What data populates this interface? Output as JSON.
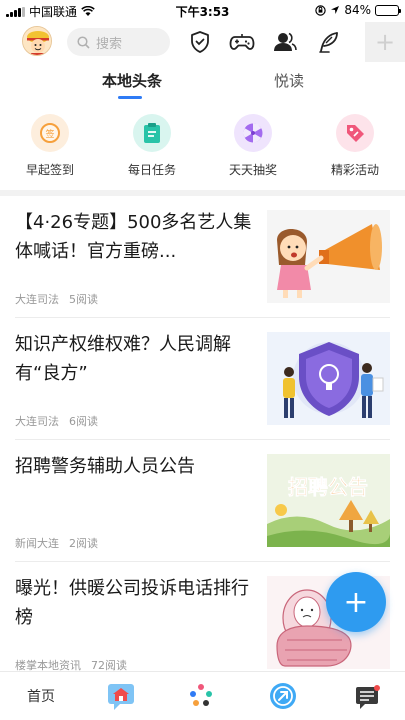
{
  "status_bar": {
    "carrier": "中国联通",
    "time": "下午3:53",
    "battery_text": "84%",
    "battery_level": 0.84
  },
  "top_bar": {
    "search_placeholder": "搜索"
  },
  "tabs": [
    {
      "label": "本地头条",
      "active": true
    },
    {
      "label": "悦读",
      "active": false
    }
  ],
  "quick_entries": [
    {
      "label": "早起签到",
      "icon": "sign-in-icon",
      "color": "#f6a03c"
    },
    {
      "label": "每日任务",
      "icon": "task-clipboard-icon",
      "color": "#28c3a8"
    },
    {
      "label": "天天抽奖",
      "icon": "lottery-wheel-icon",
      "color": "#a36bef"
    },
    {
      "label": "精彩活动",
      "icon": "gift-tag-icon",
      "color": "#f0577a"
    }
  ],
  "news": [
    {
      "title": "【4·26专题】500多名艺人集体喊话！官方重磅...",
      "source": "大连司法",
      "reads": "5阅读"
    },
    {
      "title": "知识产权维权难？人民调解有“良方”",
      "source": "大连司法",
      "reads": "6阅读"
    },
    {
      "title": "招聘警务辅助人员公告",
      "source": "新闻大连",
      "reads": "2阅读",
      "thumb_text": "招聘公告"
    },
    {
      "title": "曝光！供暖公司投诉电话排行榜",
      "source": "楼掌本地资讯",
      "reads": "72阅读"
    }
  ],
  "fab": {
    "label": "+"
  },
  "bottom_nav": {
    "home_label": "首页"
  },
  "colors": {
    "accent": "#2f7bf5",
    "fab": "#2e9bf0"
  }
}
